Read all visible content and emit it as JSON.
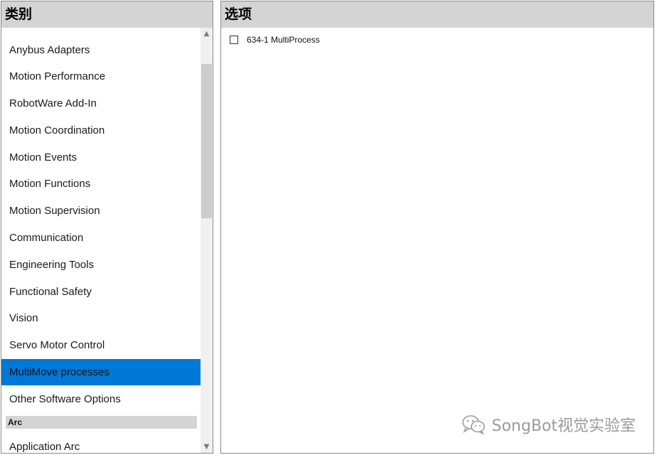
{
  "left_panel": {
    "header": "类别",
    "categories": [
      "Anybus Adapters",
      "Motion Performance",
      "RobotWare Add-In",
      "Motion Coordination",
      "Motion Events",
      "Motion Functions",
      "Motion Supervision",
      "Communication",
      "Engineering Tools",
      "Functional Safety",
      "Vision",
      "Servo Motor Control",
      "MultiMove processes",
      "Other Software Options"
    ],
    "selected_index": 12,
    "group_header": "Arc",
    "group_items": [
      "Application Arc"
    ],
    "selection_color": "#0078d7",
    "scroll_up_icon": "chevron-up-icon",
    "scroll_down_icon": "chevron-down-icon"
  },
  "right_panel": {
    "header": "选项",
    "options": [
      {
        "label": "634-1 MultiProcess",
        "checked": false
      }
    ]
  },
  "watermark": {
    "text": "SongBot视觉实验室",
    "icon": "wechat-icon"
  }
}
